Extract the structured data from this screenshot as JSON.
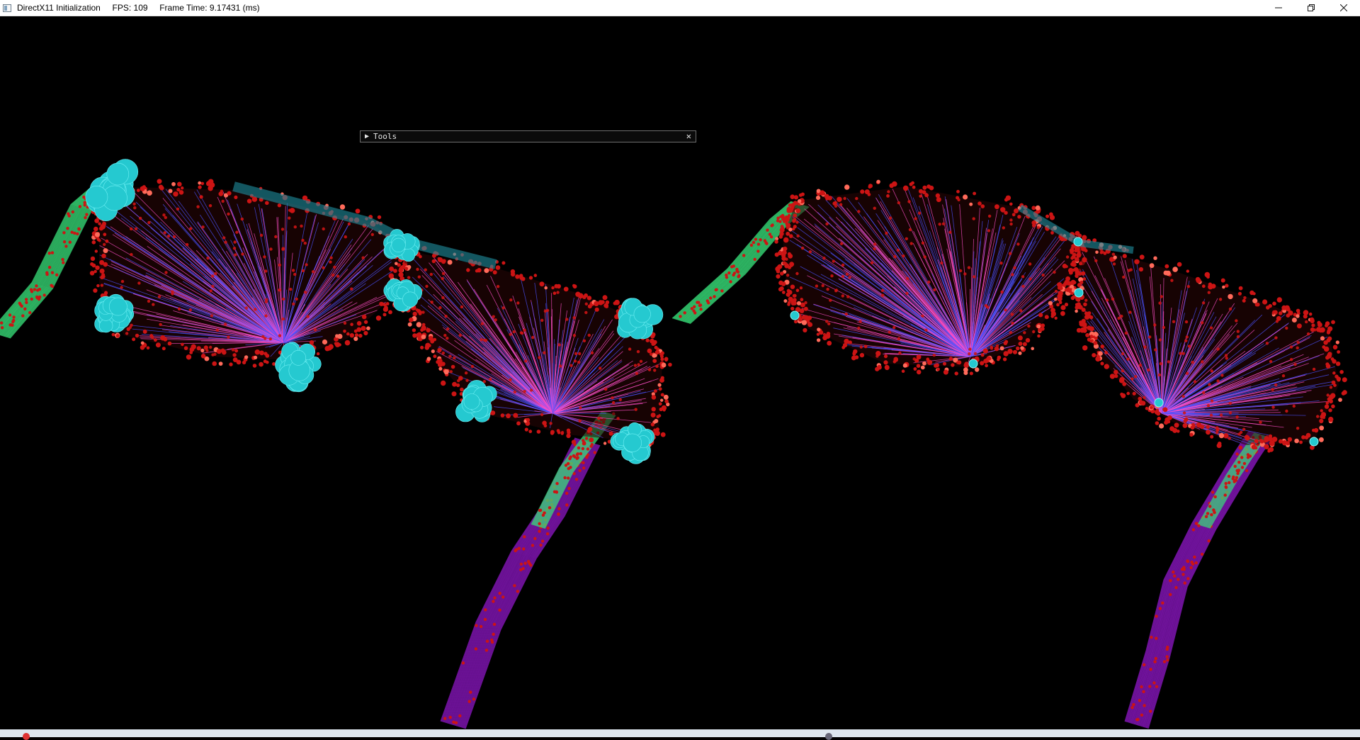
{
  "window": {
    "title": "DirectX11 Initialization",
    "fps_label": "FPS: 109",
    "frame_time_label": "Frame Time: 9.17431 (ms)"
  },
  "window_controls": {
    "minimize_icon": "minimize-icon",
    "maximize_icon": "restore-icon",
    "close_icon": "close-icon"
  },
  "tools_panel": {
    "title": "Tools",
    "collapsed": true,
    "expand_glyph": "▶",
    "close_glyph": "✕"
  },
  "scene": {
    "description_type": "3d-render",
    "views": [
      "left",
      "right"
    ],
    "colors": {
      "background": "#000000",
      "points": "#cc1414",
      "joints": "#25c9d0",
      "lines_blue": "#4a52ff",
      "lines_pink": "#ff4fc8",
      "lines_green": "#39e07a",
      "lines_purple": "#9a1ad6",
      "lines_teal": "#1f8fa0"
    }
  }
}
